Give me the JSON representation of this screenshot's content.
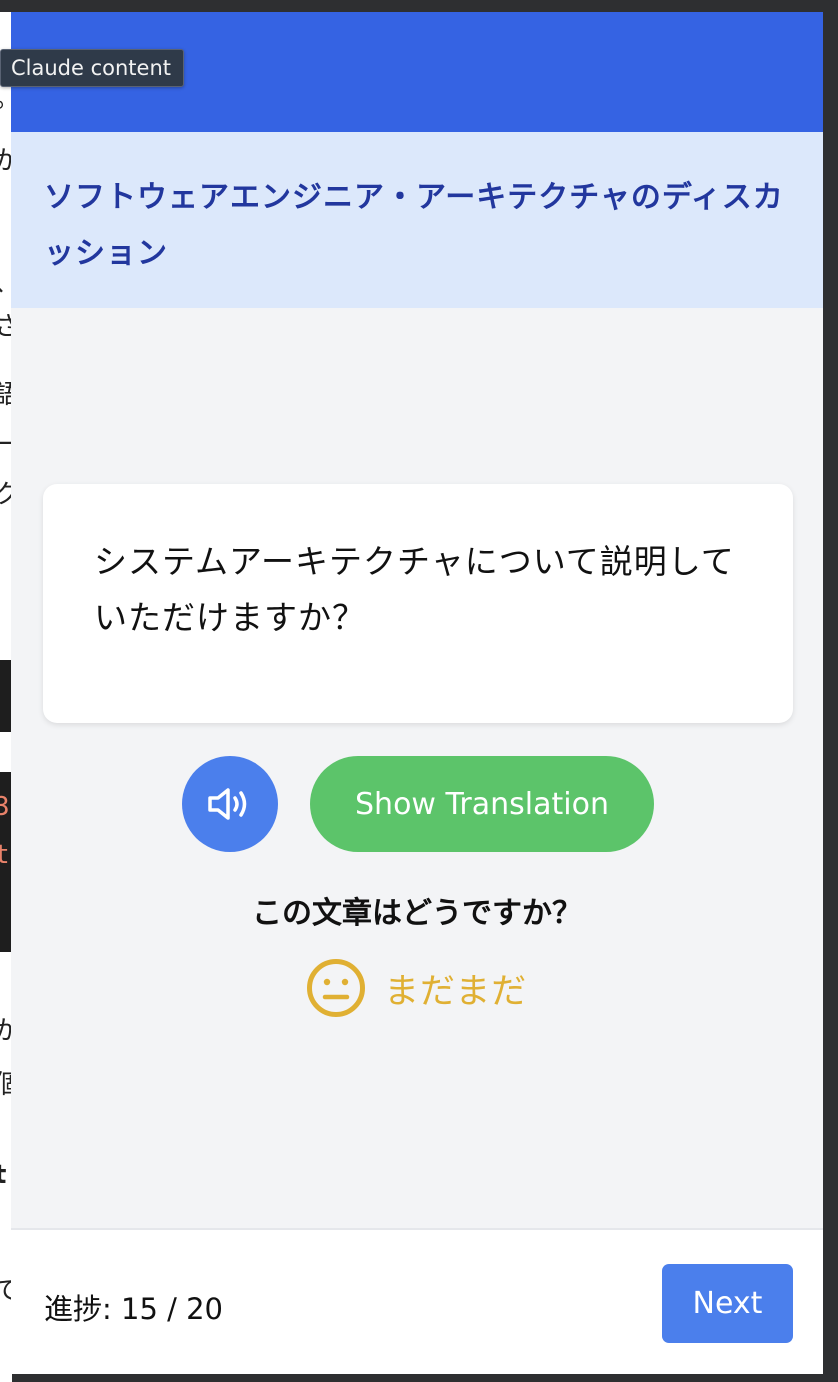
{
  "tooltip": {
    "text": "Claude content"
  },
  "header": {
    "title": "ソフトウェアエンジニア・アーキテクチャのディスカッション"
  },
  "card": {
    "sentence": "システムアーキテクチャについて説明していただけますか？"
  },
  "controls": {
    "audio_icon": "speaker-icon",
    "translate_label": "Show Translation"
  },
  "rating": {
    "question": "この文章はどうですか？",
    "icon": "neutral-face-icon",
    "label": "まだまだ",
    "color": "#e0b033"
  },
  "footer": {
    "progress_text": "進捗: 15 / 20",
    "next_label": "Next"
  },
  "colors": {
    "topbar": "#3563e3",
    "header_bg": "#dce8fb",
    "header_text": "#22379e",
    "primary_button": "#4b7fec",
    "translate_button": "#5cc46a"
  }
}
